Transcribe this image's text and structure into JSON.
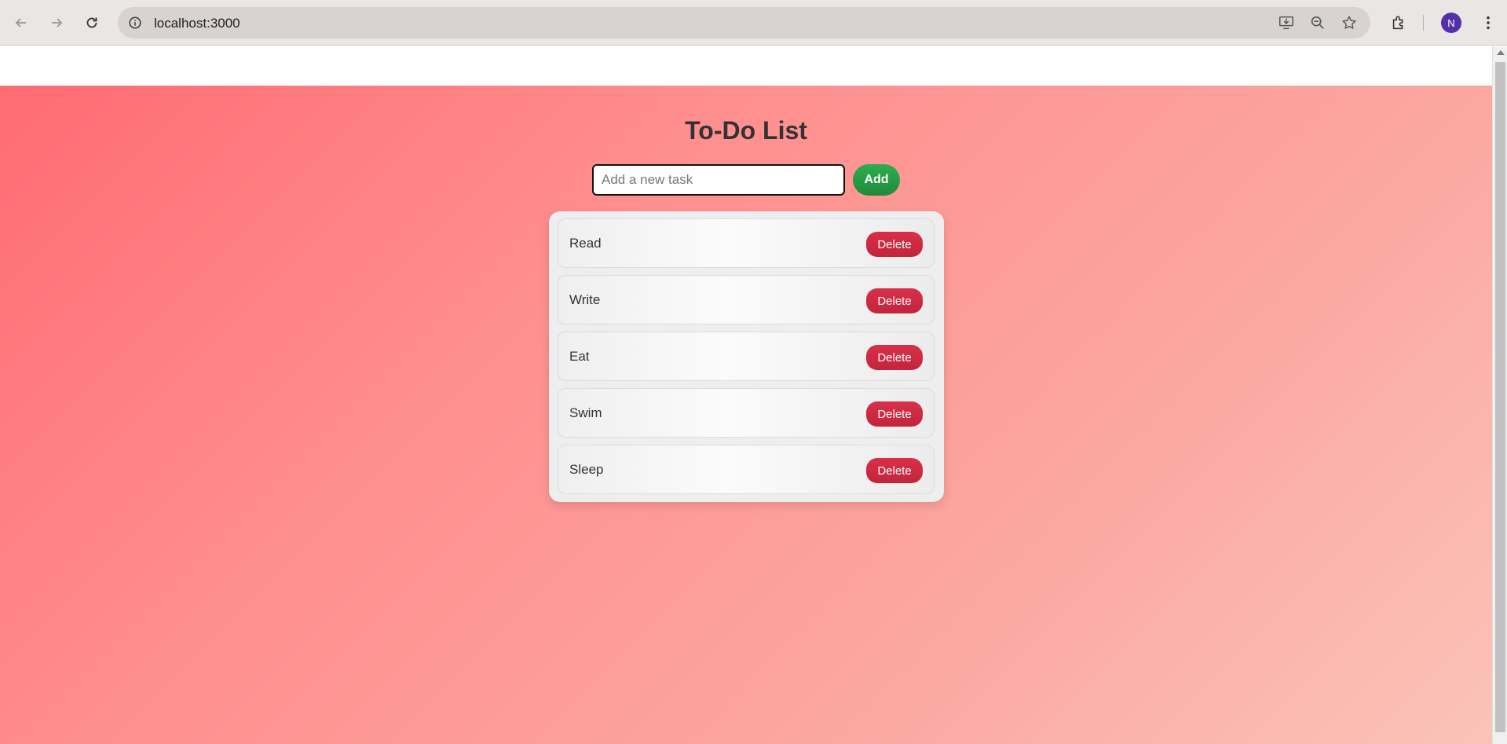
{
  "browser": {
    "url": "localhost:3000",
    "avatar_letter": "N",
    "accent_color": "#5230a8"
  },
  "app": {
    "title": "To-Do List",
    "input": {
      "placeholder": "Add a new task",
      "value": ""
    },
    "add_label": "Add",
    "tasks": [
      {
        "label": "Read",
        "delete_label": "Delete"
      },
      {
        "label": "Write",
        "delete_label": "Delete"
      },
      {
        "label": "Eat",
        "delete_label": "Delete"
      },
      {
        "label": "Swim",
        "delete_label": "Delete"
      },
      {
        "label": "Sleep",
        "delete_label": "Delete"
      }
    ],
    "colors": {
      "add_button": "#28a745",
      "delete_button": "#dc3545",
      "background_start": "#ff6b72",
      "background_end": "#fbc3b8"
    }
  }
}
